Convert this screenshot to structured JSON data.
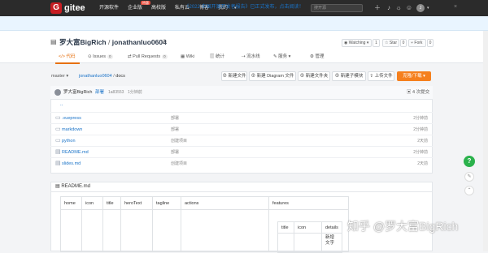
{
  "topbar": {
    "logo_letter": "G",
    "logo_text": "gitee",
    "nav": [
      "开源软件",
      "企业版",
      "高校版",
      "私有云",
      "博客",
      "我的"
    ],
    "hot_badge": "特惠",
    "search_placeholder": "搜开源",
    "icons": [
      "plus-icon",
      "bell-icon",
      "lightbulb-icon",
      "user-avatar-icon"
    ],
    "avatar_letter": "J"
  },
  "banner": {
    "text": "《2022 中国开源开发者报告》已正式发布，点击阅读！",
    "close": "×"
  },
  "repo": {
    "owner": "罗大富BigRich",
    "separator": "/",
    "name": "jonathanluo0604",
    "watching_label": "Watching",
    "watching_count": "1",
    "star_label": "Star",
    "star_count": "0",
    "fork_label": "Fork",
    "fork_count": "0"
  },
  "tabs": [
    {
      "label": "代码",
      "count": ""
    },
    {
      "label": "Issues",
      "count": "0"
    },
    {
      "label": "Pull Requests",
      "count": "0"
    },
    {
      "label": "Wiki",
      "count": ""
    },
    {
      "label": "统计",
      "count": ""
    },
    {
      "label": "流水线",
      "count": ""
    },
    {
      "label": "服务",
      "count": ""
    },
    {
      "label": "管理",
      "count": ""
    }
  ],
  "toolbar": {
    "branch": "master",
    "crumb_root": "jonathanluo0604",
    "crumb_sep": "/",
    "crumb_current": "docs",
    "buttons": [
      "新建文件",
      "新建 Diagram 文件",
      "新建文件夹",
      "新建子模块",
      "上传文件"
    ],
    "clone_label": "克隆/下载"
  },
  "commit": {
    "author": "罗大富BigRich",
    "message": "部署",
    "hash": "1a83553",
    "time": "1分钟前",
    "count_label": "4 次提交"
  },
  "parent_dir": "..",
  "files": [
    {
      "name": ".vuepress",
      "type": "folder",
      "message": "部署",
      "time": "2分钟前"
    },
    {
      "name": "markdown",
      "type": "folder",
      "message": "部署",
      "time": "2分钟前"
    },
    {
      "name": "python",
      "type": "folder",
      "message": "创建项目",
      "time": "2天前"
    },
    {
      "name": "README.md",
      "type": "file",
      "message": "部署",
      "time": "2分钟前"
    },
    {
      "name": "slides.md",
      "type": "file",
      "message": "创建项目",
      "time": "2天前"
    }
  ],
  "readme": {
    "title": "README.md",
    "headers": [
      "home",
      "icon",
      "title",
      "heroText",
      "tagline",
      "actions",
      "features"
    ],
    "inner_headers": [
      "title",
      "icon",
      "details"
    ],
    "inner_cell": "新增文字"
  },
  "watermark": "知乎 @罗大富BigRich",
  "float_buttons": [
    "help-icon",
    "edit-icon",
    "back-to-top-icon"
  ]
}
